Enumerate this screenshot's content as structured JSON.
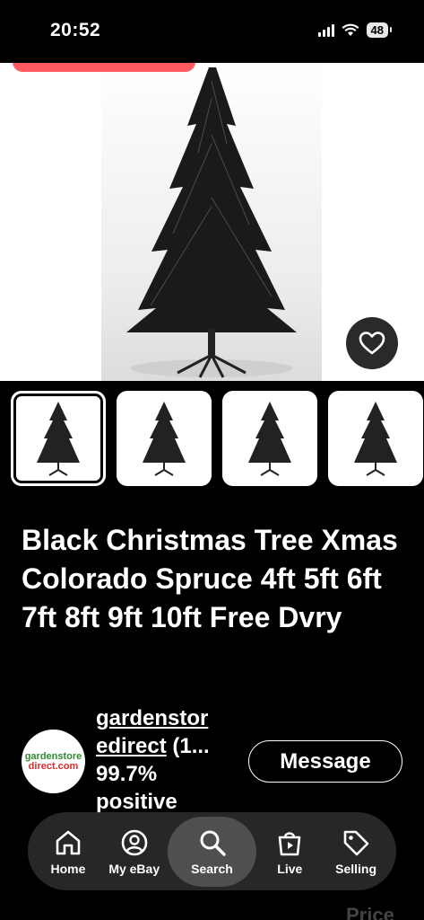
{
  "status_bar": {
    "time": "20:52",
    "battery": "48"
  },
  "product": {
    "title": "Black Christmas Tree Xmas Colorado Spruce 4ft 5ft 6ft 7ft 8ft 9ft 10ft Free Dvry",
    "thumbnail_count_visible": 4,
    "selected_thumbnail": 1
  },
  "seller": {
    "logo_top": "gardenstore",
    "logo_bottom": "direct.com",
    "name": "gardenstoredirect",
    "name_line1": "gardenstor",
    "name_line2": "edirect",
    "count": "(1...",
    "feedback": "99.7%",
    "feedback_label": "positive",
    "message_label": "Message"
  },
  "below_fold": {
    "price_label": "Price"
  },
  "bottom_nav": [
    {
      "label": "Home",
      "icon": "home-icon"
    },
    {
      "label": "My eBay",
      "icon": "user-icon"
    },
    {
      "label": "Search",
      "icon": "search-icon",
      "active": true
    },
    {
      "label": "Live",
      "icon": "live-bag-icon"
    },
    {
      "label": "Selling",
      "icon": "tag-icon"
    }
  ]
}
